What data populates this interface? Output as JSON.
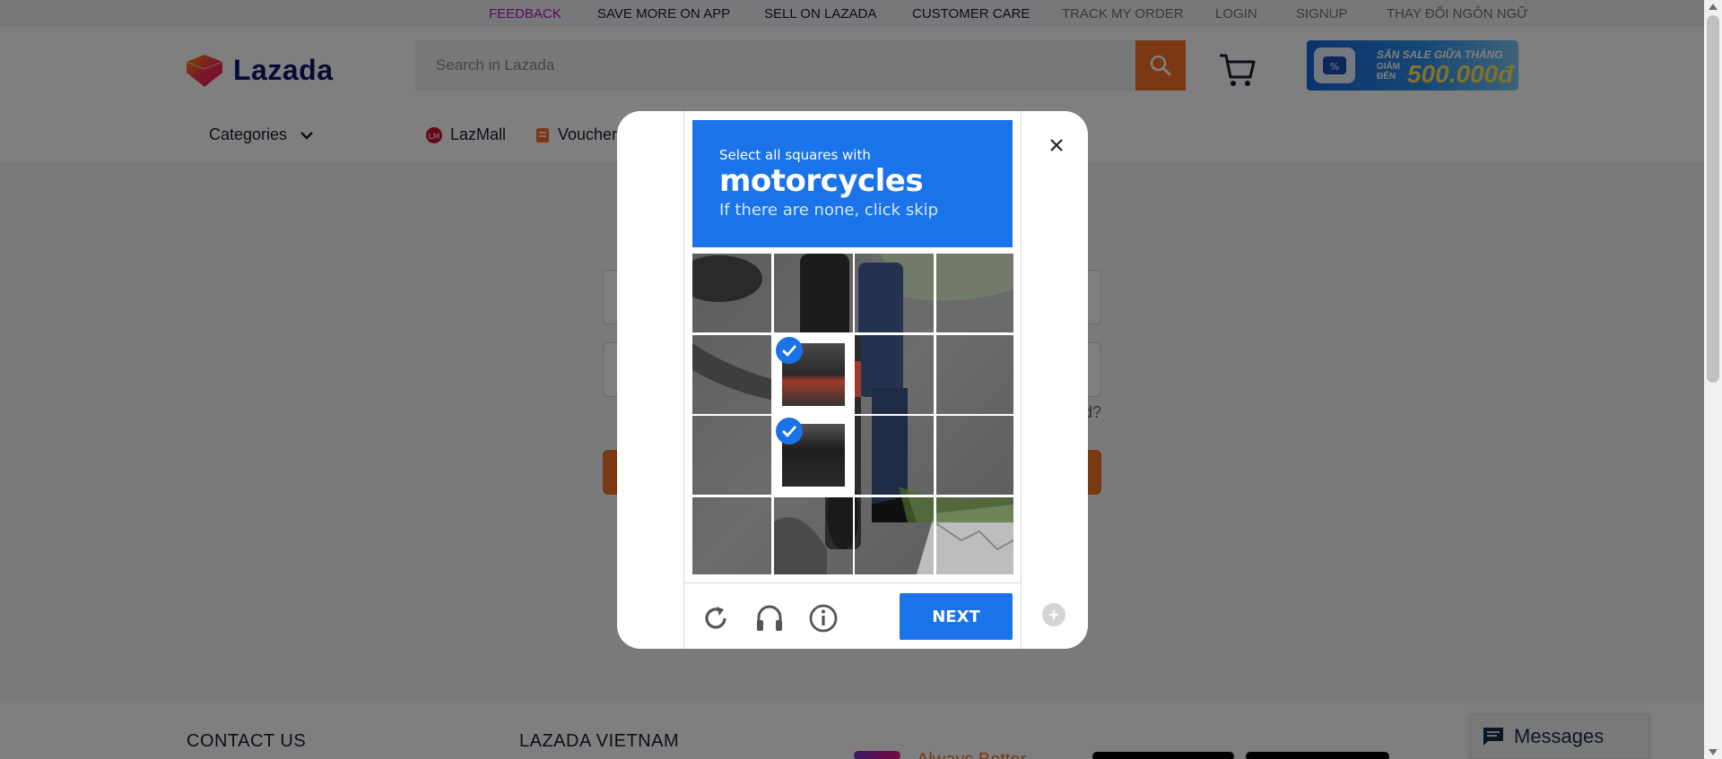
{
  "topbar": {
    "feedback": "FEEDBACK",
    "save_more": "SAVE MORE ON APP",
    "sell": "SELL ON LAZADA",
    "care": "CUSTOMER CARE",
    "track": "TRACK MY ORDER",
    "login": "LOGIN",
    "signup": "SIGNUP",
    "language": "THAY ĐỔI NGÔN NGỮ"
  },
  "header": {
    "logo_text": "Lazada",
    "search_placeholder": "Search in Lazada",
    "promo": {
      "line1": "SĂN SALE GIỮA THÁNG",
      "line2": "GIẢM ĐẾN",
      "amount": "500.000đ"
    }
  },
  "nav": {
    "categories": "Categories",
    "lazmall": "LazMall",
    "vouchers": "Vouchers"
  },
  "login_form": {
    "forgot_suffix": "d?"
  },
  "footer": {
    "contact": "CONTACT US",
    "vietnam": "LAZADA VIETNAM",
    "always_better": "Always Better"
  },
  "messages": {
    "label": "Messages"
  },
  "captcha": {
    "instruction": "Select all squares with",
    "target": "motorcycles",
    "hint": "If there are none, click skip",
    "next_label": "NEXT",
    "selected_tiles": [
      5,
      9
    ],
    "tile_count": 16,
    "icons": [
      "reload-icon",
      "audio-icon",
      "info-icon"
    ]
  },
  "colors": {
    "brand_orange": "#f57224",
    "captcha_blue": "#1a73e8",
    "lazada_navy": "#0f146d"
  }
}
